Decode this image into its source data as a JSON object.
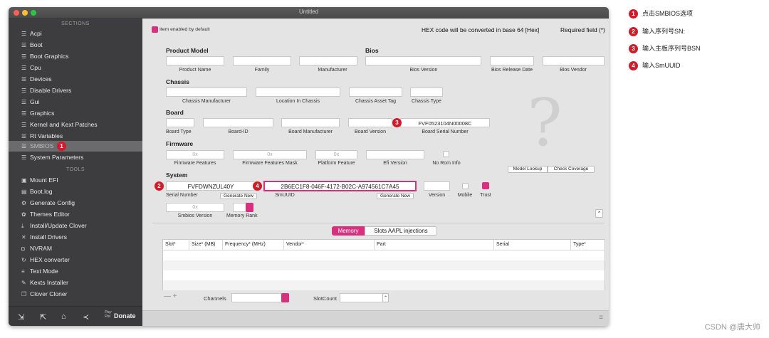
{
  "window": {
    "title": "Untitled"
  },
  "sidebar": {
    "section_sections": "SECTIONS",
    "items": [
      "Acpi",
      "Boot",
      "Boot Graphics",
      "Cpu",
      "Devices",
      "Disable Drivers",
      "Gui",
      "Graphics",
      "Kernel and Kext Patches",
      "Rt Variables",
      "SMBIOS",
      "System Parameters"
    ],
    "section_tools": "TOOLS",
    "tools": [
      "Mount EFI",
      "Boot.log",
      "Generate Config",
      "Themes Editor",
      "Install/Update Clover",
      "Install Drivers",
      "NVRAM",
      "HEX converter",
      "Text Mode",
      "Kexts Installer",
      "Clover Cloner"
    ],
    "donate_label": "Donate",
    "paypal_mark": "Pay Pal"
  },
  "header": {
    "item_enabled_note": "Item enabled by default",
    "hex_note": "HEX code will be converted in base 64 [Hex]",
    "required_note": "Required field (*)"
  },
  "product": {
    "title": "Product Model",
    "labels": [
      "Product Name",
      "Family",
      "Manufacturer"
    ]
  },
  "bios": {
    "title": "Bios",
    "labels": [
      "Bios Version",
      "Bios Release Date",
      "Bios Vendor"
    ]
  },
  "chassis": {
    "title": "Chassis",
    "labels": [
      "Chassis Manufacturer",
      "Location In Chassis",
      "Chassis  Asset Tag",
      "Chassis Type"
    ]
  },
  "board": {
    "title": "Board",
    "labels": [
      "Board Type",
      "Board-ID",
      "Board Manufacturer",
      "Board Version",
      "Board Serial Number"
    ],
    "serial_value": "FVF0523104N00008C"
  },
  "firmware": {
    "title": "Firmware",
    "placeholder": "0x",
    "labels": [
      "Firmware Features",
      "Firmware Features Mask",
      "Platform Feature",
      "Efi Version",
      "No Rom Info"
    ]
  },
  "system": {
    "title": "System",
    "serial_value": "FVFDWNZUL40Y",
    "serial_label": "Serial Number",
    "generate_label": "Generate New",
    "smuuid_value": "2B6EC1F8-046F-4172-B02C-A974561C7A45",
    "smuuid_label": "SmUUID",
    "version_label": "Version",
    "mobile_label": "Mobile",
    "trust_label": "Trust",
    "smbios_version_placeholder": "0x",
    "smbios_version_label": "Smbios Version",
    "memory_rank_label": "Memory Rank"
  },
  "lookup": {
    "model_lookup": "Model Lookup",
    "check_coverage": "Check Coverage"
  },
  "memory": {
    "tab_memory": "Memory",
    "tab_slots": "Slots AAPL injections",
    "columns": [
      "Slot*",
      "Size* (MB)",
      "Frequency* (MHz)",
      "Vendor*",
      "Part",
      "Serial",
      "Type*"
    ],
    "channels_label": "Channels",
    "slotcount_label": "SlotCount",
    "add_remove": "— +"
  },
  "badges": [
    "1",
    "2",
    "3",
    "4"
  ],
  "annotations": [
    {
      "num": "1",
      "text": "点击SMBIOS选项"
    },
    {
      "num": "2",
      "text": "输入序列号SN:"
    },
    {
      "num": "3",
      "text": "输入主板序列号BSN"
    },
    {
      "num": "4",
      "text": "输入SmUUID"
    }
  ],
  "watermark": "CSDN @唐大帅",
  "colors": {
    "accent": "#d6307f",
    "badge": "#d01c2a",
    "sidebar_bg": "#3d3d3f"
  }
}
